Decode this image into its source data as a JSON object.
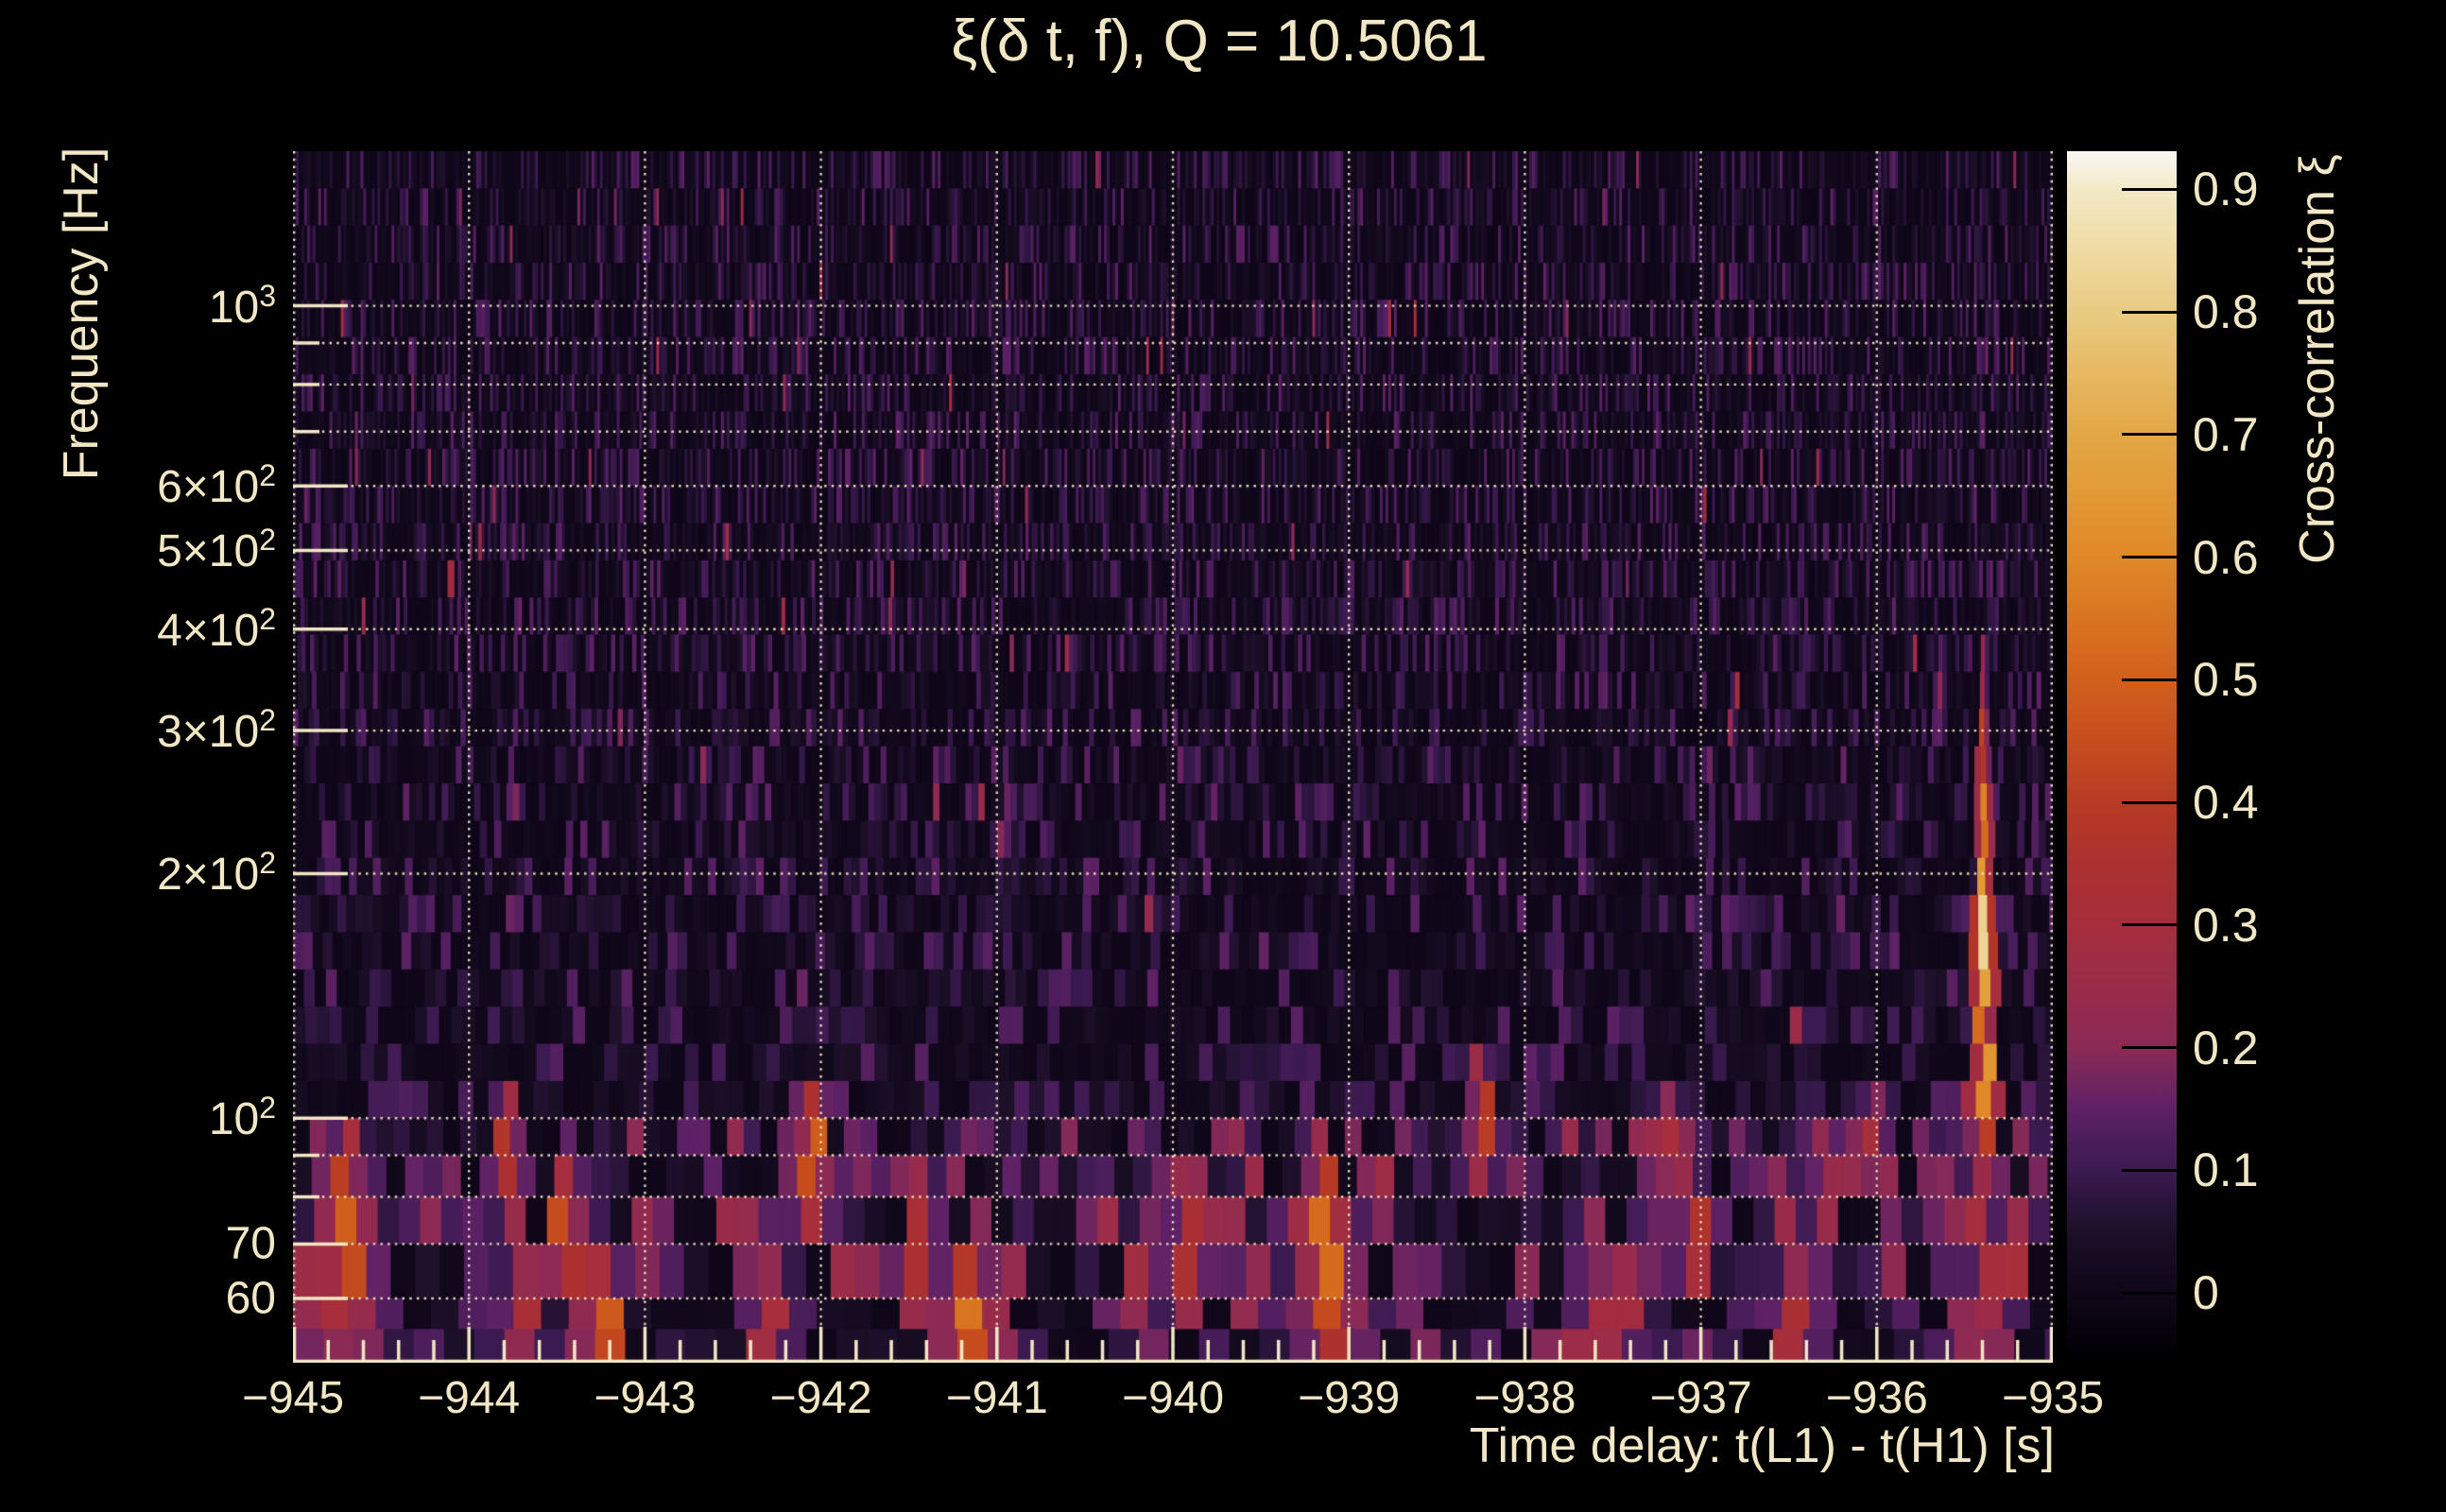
{
  "title": "ξ(δ t, f), Q = 10.5061",
  "axes": {
    "x_label": "Time delay: t(L1) - t(H1) [s]",
    "y_label": "Frequency [Hz]",
    "colorbar_label": "Cross-correlation ξ"
  },
  "colors": {
    "background": "#000000",
    "text": "#f2e7c4",
    "grid": "#efe5c2",
    "colorbar_tick": "#000000"
  },
  "chart_data": {
    "type": "heatmap",
    "title": "ξ(δ t, f), Q = 10.5061",
    "q_value": 10.5061,
    "xlabel": "Time delay: t(L1) - t(H1) [s]",
    "ylabel": "Frequency [Hz]",
    "zlabel": "Cross-correlation ξ",
    "x_range": [
      -945,
      -935
    ],
    "y_range_hz": [
      50,
      1550
    ],
    "y_scale": "log",
    "z_range": [
      -0.053,
      0.931
    ],
    "grid": true,
    "x_minor_step": 0.2,
    "x_ticks": [
      {
        "value": -945,
        "label": "−945"
      },
      {
        "value": -944,
        "label": "−944"
      },
      {
        "value": -943,
        "label": "−943"
      },
      {
        "value": -942,
        "label": "−942"
      },
      {
        "value": -941,
        "label": "−941"
      },
      {
        "value": -940,
        "label": "−940"
      },
      {
        "value": -939,
        "label": "−939"
      },
      {
        "value": -938,
        "label": "−938"
      },
      {
        "value": -937,
        "label": "−937"
      },
      {
        "value": -936,
        "label": "−936"
      },
      {
        "value": -935,
        "label": "−935"
      }
    ],
    "y_ticks": [
      {
        "value": 1000,
        "label": "10",
        "sup": "3"
      },
      {
        "value": 600,
        "label": "6×10",
        "sup": "2"
      },
      {
        "value": 500,
        "label": "5×10",
        "sup": "2"
      },
      {
        "value": 400,
        "label": "4×10",
        "sup": "2"
      },
      {
        "value": 300,
        "label": "3×10",
        "sup": "2"
      },
      {
        "value": 200,
        "label": "2×10",
        "sup": "2"
      },
      {
        "value": 100,
        "label": "10",
        "sup": "2"
      },
      {
        "value": 70,
        "label": "70",
        "sup": ""
      },
      {
        "value": 60,
        "label": "60",
        "sup": ""
      }
    ],
    "y_grid_hz": [
      60,
      70,
      80,
      90,
      100,
      200,
      300,
      400,
      500,
      600,
      700,
      800,
      900,
      1000
    ],
    "colorbar_ticks": [
      {
        "value": 0.9,
        "label": "0.9"
      },
      {
        "value": 0.8,
        "label": "0.8"
      },
      {
        "value": 0.7,
        "label": "0.7"
      },
      {
        "value": 0.6,
        "label": "0.6"
      },
      {
        "value": 0.5,
        "label": "0.5"
      },
      {
        "value": 0.4,
        "label": "0.4"
      },
      {
        "value": 0.3,
        "label": "0.3"
      },
      {
        "value": 0.2,
        "label": "0.2"
      },
      {
        "value": 0.1,
        "label": "0.1"
      },
      {
        "value": 0.0,
        "label": "0"
      }
    ],
    "colormap_stops": [
      [
        -0.053,
        "#000002"
      ],
      [
        0.0,
        "#0f0719"
      ],
      [
        0.05,
        "#1c0f28"
      ],
      [
        0.1,
        "#3b1a51"
      ],
      [
        0.15,
        "#5e2165"
      ],
      [
        0.2,
        "#8b2a55"
      ],
      [
        0.25,
        "#9a2b49"
      ],
      [
        0.3,
        "#a62e3c"
      ],
      [
        0.35,
        "#ac3030"
      ],
      [
        0.4,
        "#b83b24"
      ],
      [
        0.45,
        "#c74d1e"
      ],
      [
        0.5,
        "#d2601c"
      ],
      [
        0.55,
        "#d97420"
      ],
      [
        0.6,
        "#e08827"
      ],
      [
        0.65,
        "#e29934"
      ],
      [
        0.7,
        "#e3a746"
      ],
      [
        0.75,
        "#e6b961"
      ],
      [
        0.8,
        "#e9cb82"
      ],
      [
        0.85,
        "#efdba3"
      ],
      [
        0.9,
        "#f3e9c6"
      ],
      [
        0.931,
        "#faf8f4"
      ]
    ],
    "low_band_row_edges_hz": [
      100,
      90,
      80,
      70,
      60,
      55,
      50
    ],
    "noise_seed": 1337,
    "features": [
      {
        "t": -944.86,
        "f_lo": 55,
        "f_hi": 72,
        "xi": 0.28
      },
      {
        "t": -944.69,
        "f_lo": 58,
        "f_hi": 92,
        "xi": 0.5
      },
      {
        "t": -944.6,
        "f_lo": 55,
        "f_hi": 75,
        "xi": 0.3
      },
      {
        "t": -943.78,
        "f_lo": 78,
        "f_hi": 108,
        "xi": 0.38
      },
      {
        "t": -943.7,
        "f_lo": 52,
        "f_hi": 66,
        "xi": 0.33
      },
      {
        "t": -943.44,
        "f_lo": 62,
        "f_hi": 86,
        "xi": 0.45
      },
      {
        "t": -943.24,
        "f_lo": 50,
        "f_hi": 62,
        "xi": 0.5
      },
      {
        "t": -942.3,
        "f_lo": 50,
        "f_hi": 62,
        "xi": 0.32
      },
      {
        "t": -942.05,
        "f_lo": 78,
        "f_hi": 108,
        "xi": 0.5
      },
      {
        "t": -941.42,
        "f_lo": 60,
        "f_hi": 80,
        "xi": 0.38
      },
      {
        "t": -941.13,
        "f_lo": 50,
        "f_hi": 66,
        "xi": 0.55
      },
      {
        "t": -941.6,
        "f_lo": 390,
        "f_hi": 430,
        "xi": 0.2
      },
      {
        "t": -940.17,
        "f_lo": 55,
        "f_hi": 75,
        "xi": 0.28
      },
      {
        "t": -939.94,
        "f_lo": 60,
        "f_hi": 80,
        "xi": 0.38
      },
      {
        "t": -939.46,
        "f_lo": 58,
        "f_hi": 72,
        "xi": 0.22
      },
      {
        "t": -939.15,
        "f_lo": 55,
        "f_hi": 88,
        "xi": 0.55
      },
      {
        "t": -939.05,
        "f_lo": 50,
        "f_hi": 70,
        "xi": 0.45
      },
      {
        "t": -938.5,
        "f_lo": 390,
        "f_hi": 420,
        "xi": 0.18
      },
      {
        "t": -938.25,
        "f_lo": 85,
        "f_hi": 115,
        "xi": 0.42
      },
      {
        "t": -937.63,
        "f_lo": 50,
        "f_hi": 62,
        "xi": 0.3
      },
      {
        "t": -937.47,
        "f_lo": 50,
        "f_hi": 62,
        "xi": 0.3
      },
      {
        "t": -937.2,
        "f_lo": 85,
        "f_hi": 102,
        "xi": 0.32
      },
      {
        "t": -937.05,
        "f_lo": 62,
        "f_hi": 82,
        "xi": 0.38
      },
      {
        "t": -936.44,
        "f_lo": 50,
        "f_hi": 62,
        "xi": 0.35
      },
      {
        "t": -936.32,
        "f_lo": 70,
        "f_hi": 82,
        "xi": 0.25
      },
      {
        "t": -935.99,
        "f_lo": 88,
        "f_hi": 102,
        "xi": 0.3
      },
      {
        "t": -935.63,
        "f_lo": 300,
        "f_hi": 360,
        "xi": 0.22
      },
      {
        "t": -935.39,
        "f_lo": 50,
        "f_hi": 95,
        "xi": 0.3
      },
      {
        "t": -935.39,
        "f_lo": 95,
        "f_hi": 135,
        "xi": 0.65
      },
      {
        "t": -935.39,
        "f_lo": 135,
        "f_hi": 210,
        "xi": 0.85
      },
      {
        "t": -935.39,
        "f_lo": 210,
        "f_hi": 270,
        "xi": 0.6
      },
      {
        "t": -935.39,
        "f_lo": 270,
        "f_hi": 330,
        "xi": 0.42
      },
      {
        "t": -935.39,
        "f_lo": 330,
        "f_hi": 390,
        "xi": 0.25
      }
    ]
  }
}
